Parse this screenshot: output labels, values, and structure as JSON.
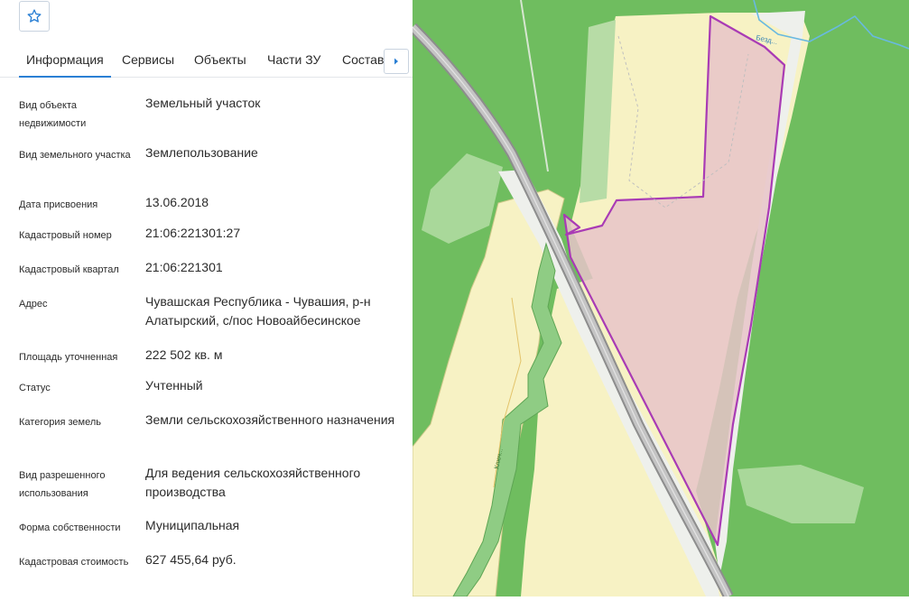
{
  "tabs": [
    {
      "label": "Информация",
      "active": true
    },
    {
      "label": "Сервисы",
      "active": false
    },
    {
      "label": "Объекты",
      "active": false
    },
    {
      "label": "Части ЗУ",
      "active": false
    },
    {
      "label": "Состав",
      "active": false
    }
  ],
  "properties": [
    {
      "label": "Вид объекта недвижимости",
      "value": "Земельный участок"
    },
    {
      "label": "Вид земельного участка",
      "value": "Землепользование"
    },
    {
      "label": "Дата присвоения",
      "value": "13.06.2018"
    },
    {
      "label": "Кадастровый номер",
      "value": "21:06:221301:27"
    },
    {
      "label": "Кадастровый квартал",
      "value": "21:06:221301"
    },
    {
      "label": "Адрес",
      "value": "Чувашская Республика - Чувашия, р-н Алатырский, с/пос Новоайбесинское"
    },
    {
      "label": "Площадь уточненная",
      "value": "222 502 кв. м"
    },
    {
      "label": "Статус",
      "value": "Учтенный"
    },
    {
      "label": "Категория земель",
      "value": "Земли сельскохозяйственного назначения"
    },
    {
      "label": "Вид разрешенного использования",
      "value": "Для ведения сельскохозяйственного производства"
    },
    {
      "label": "Форма собственности",
      "value": "Муниципальная"
    },
    {
      "label": "Кадастровая стоимость",
      "value": "627 455,64 руб."
    }
  ],
  "map": {
    "river_label": "Безд...",
    "stream_label": "Ключ..."
  },
  "colors": {
    "accent": "#2a7fd4",
    "forest": "#6fbd5f",
    "field": "#f7f2c4",
    "parcel_fill": "#e8c4c9",
    "parcel_border": "#a93bb5",
    "road": "#a8a8a8",
    "river": "#69b9e0"
  }
}
